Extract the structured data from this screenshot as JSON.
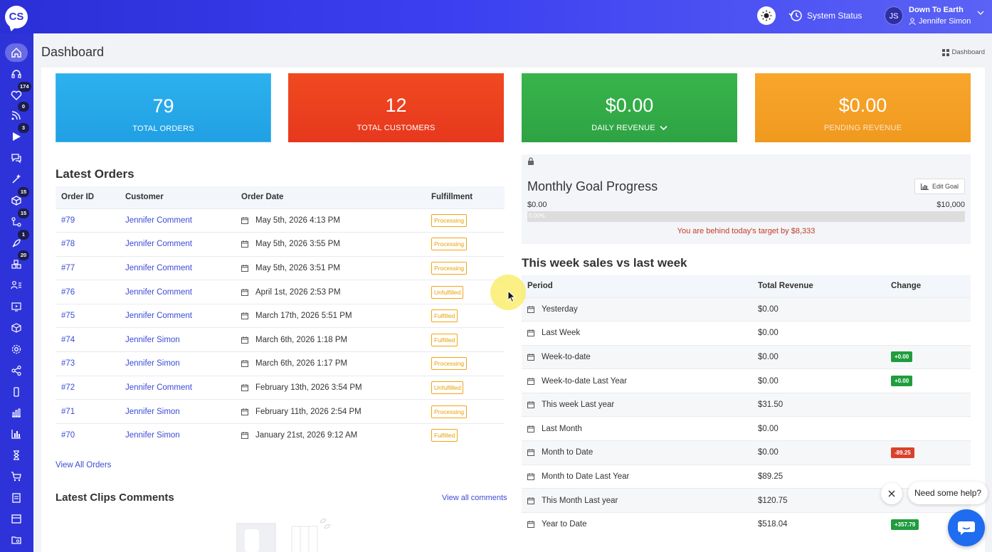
{
  "header": {
    "logo_text": "CS",
    "system_status": "System Status",
    "user": {
      "initials": "JS",
      "org": "Down To Earth",
      "name": "Jennifer Simon"
    }
  },
  "sidebar": {
    "badges": {
      "orders": "174",
      "feeds": "0",
      "videos": "3",
      "products": "15",
      "analytics": "15",
      "marketing": "1",
      "inventory": "20"
    }
  },
  "page": {
    "title": "Dashboard",
    "breadcrumb": "Dashboard"
  },
  "stats": [
    {
      "value": "79",
      "label": "TOTAL ORDERS"
    },
    {
      "value": "12",
      "label": "TOTAL CUSTOMERS"
    },
    {
      "value": "$0.00",
      "label": "DAILY REVENUE"
    },
    {
      "value": "$0.00",
      "label": "PENDING REVENUE"
    }
  ],
  "latest_orders": {
    "title": "Latest Orders",
    "columns": [
      "Order ID",
      "Customer",
      "Order Date",
      "Fulfillment"
    ],
    "rows": [
      {
        "id": "#79",
        "customer": "Jennifer Comment",
        "date": "May 5th, 2026 4:13 PM",
        "status": "Processing"
      },
      {
        "id": "#78",
        "customer": "Jennifer Comment",
        "date": "May 5th, 2026 3:55 PM",
        "status": "Processing"
      },
      {
        "id": "#77",
        "customer": "Jennifer Comment",
        "date": "May 5th, 2026 3:51 PM",
        "status": "Processing"
      },
      {
        "id": "#76",
        "customer": "Jennifer Comment",
        "date": "April 1st, 2026 2:53 PM",
        "status": "Unfulfilled"
      },
      {
        "id": "#75",
        "customer": "Jennifer Comment",
        "date": "March 17th, 2026 5:51 PM",
        "status": "Fulfilled"
      },
      {
        "id": "#74",
        "customer": "Jennifer Simon",
        "date": "March 6th, 2026 1:18 PM",
        "status": "Fulfilled"
      },
      {
        "id": "#73",
        "customer": "Jennifer Simon",
        "date": "March 6th, 2026 1:17 PM",
        "status": "Processing"
      },
      {
        "id": "#72",
        "customer": "Jennifer Comment",
        "date": "February 13th, 2026 3:54 PM",
        "status": "Unfulfilled"
      },
      {
        "id": "#71",
        "customer": "Jennifer Simon",
        "date": "February 11th, 2026 2:54 PM",
        "status": "Processing"
      },
      {
        "id": "#70",
        "customer": "Jennifer Simon",
        "date": "January 21st, 2026 9:12 AM",
        "status": "Fulfilled"
      }
    ],
    "view_all": "View All Orders"
  },
  "clips": {
    "title": "Latest Clips Comments",
    "view_all": "View all comments"
  },
  "goal": {
    "title": "Monthly Goal Progress",
    "edit_label": "Edit Goal",
    "min": "$0.00",
    "max": "$10,000",
    "percent_label": "0.00%",
    "progress": 0,
    "message": "You are behind today's target by $8,333"
  },
  "sales": {
    "title": "This week sales vs last week",
    "columns": [
      "Period",
      "Total Revenue",
      "Change"
    ],
    "rows": [
      {
        "period": "Yesterday",
        "revenue": "$0.00",
        "change": "",
        "dir": ""
      },
      {
        "period": "Last Week",
        "revenue": "$0.00",
        "change": "",
        "dir": ""
      },
      {
        "period": "Week-to-date",
        "revenue": "$0.00",
        "change": "+0.00",
        "dir": "up"
      },
      {
        "period": "Week-to-date Last Year",
        "revenue": "$0.00",
        "change": "+0.00",
        "dir": "up"
      },
      {
        "period": "This week Last year",
        "revenue": "$31.50",
        "change": "",
        "dir": ""
      },
      {
        "period": "Last Month",
        "revenue": "$0.00",
        "change": "",
        "dir": ""
      },
      {
        "period": "Month to Date",
        "revenue": "$0.00",
        "change": "-89.25",
        "dir": "down"
      },
      {
        "period": "Month to Date Last Year",
        "revenue": "$89.25",
        "change": "",
        "dir": ""
      },
      {
        "period": "This Month Last year",
        "revenue": "$120.75",
        "change": "",
        "dir": ""
      },
      {
        "period": "Year to Date",
        "revenue": "$518.04",
        "change": "+357.79",
        "dir": "up"
      }
    ]
  },
  "help": {
    "bubble": "Need some help?"
  }
}
